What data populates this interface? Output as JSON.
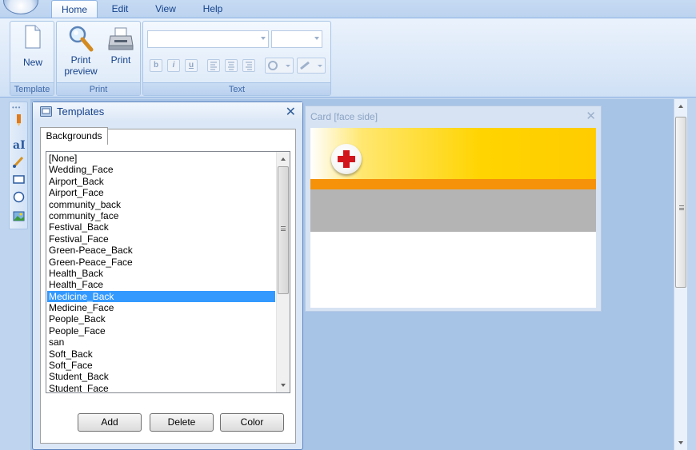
{
  "ribbon": {
    "tabs": [
      {
        "label": "Home",
        "active": true
      },
      {
        "label": "Edit",
        "active": false
      },
      {
        "label": "View",
        "active": false
      },
      {
        "label": "Help",
        "active": false
      }
    ],
    "groups": {
      "template": {
        "label": "Template",
        "new_label": "New"
      },
      "print": {
        "label": "Print",
        "preview_label_1": "Print",
        "preview_label_2": "preview",
        "print_label": "Print"
      },
      "text": {
        "label": "Text",
        "bold": "b",
        "italic": "i",
        "underline": "u"
      }
    }
  },
  "templates_panel": {
    "title": "Templates",
    "tab_label": "Backgrounds",
    "items": [
      "[None]",
      "Wedding_Face",
      "Airport_Back",
      "Airport_Face",
      "community_back",
      "community_face",
      "Festival_Back",
      "Festival_Face",
      "Green-Peace_Back",
      "Green-Peace_Face",
      "Health_Back",
      "Health_Face",
      "Medicine_Back",
      "Medicine_Face",
      "People_Back",
      "People_Face",
      "san",
      "Soft_Back",
      "Soft_Face",
      "Student_Back",
      "Student_Face"
    ],
    "selected": "Medicine_Back",
    "buttons": {
      "add": "Add",
      "delete": "Delete",
      "color": "Color"
    }
  },
  "card_panel": {
    "title": "Card [face side]"
  },
  "colors": {
    "selection": "#3399ff",
    "card_yellow": "#ffd400",
    "card_orange": "#f5920a",
    "card_gray": "#b4b4b4",
    "cross_red": "#d2141c"
  },
  "icons": [
    "app-orb-icon",
    "new-document-icon",
    "print-preview-icon",
    "printer-icon",
    "templates-icon",
    "close-icon",
    "medical-cross-icon"
  ]
}
